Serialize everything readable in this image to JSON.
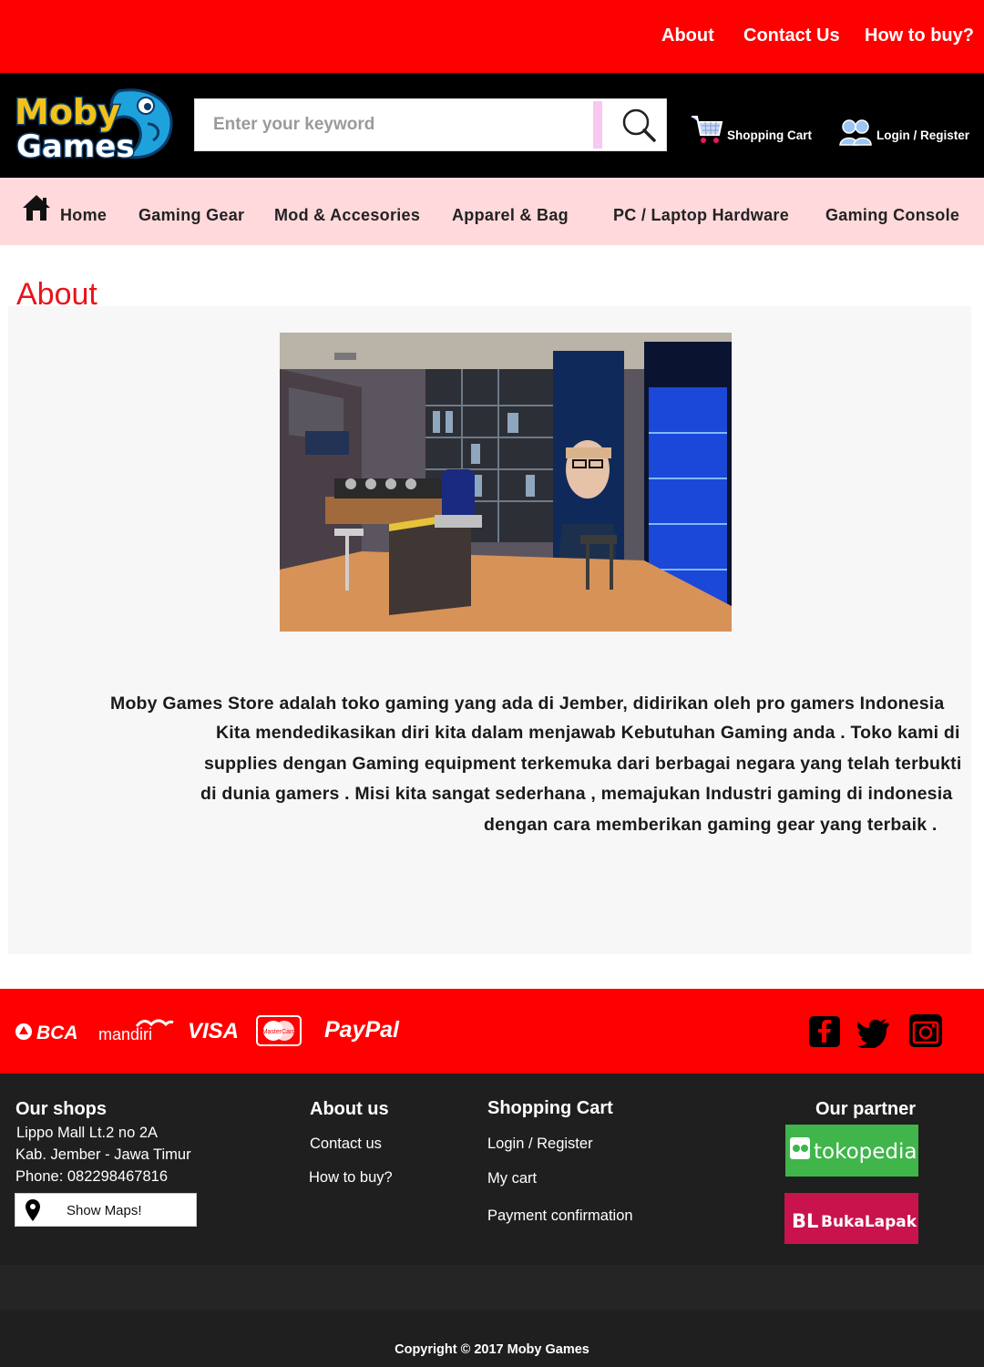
{
  "topnav": {
    "about": "About",
    "contact": "Contact Us",
    "howto": "How to buy?"
  },
  "brand": {
    "line1": "Moby",
    "line2": "Games"
  },
  "search": {
    "placeholder": "Enter your keyword"
  },
  "header": {
    "cart": "Shopping Cart",
    "login": "Login / Register"
  },
  "nav": {
    "home": "Home",
    "gaming_gear": "Gaming Gear",
    "mod": "Mod & Accesories",
    "apparel": "Apparel & Bag",
    "pc": "PC / Laptop Hardware",
    "console": "Gaming Console"
  },
  "about": {
    "title": "About",
    "lines": [
      "Moby Games Store adalah toko gaming yang ada di Jember, didirikan oleh pro gamers Indonesia",
      "Kita mendedikasikan diri kita dalam menjawab Kebutuhan Gaming anda . Toko kami di",
      "supplies dengan Gaming equipment terkemuka dari berbagai negara yang telah terbukti",
      "di dunia gamers . Misi kita sangat sederhana , memajukan Industri gaming di indonesia",
      "dengan cara memberikan gaming gear yang terbaik ."
    ]
  },
  "payments": {
    "bca": "BCA",
    "mandiri": "mandiri",
    "visa": "VISA",
    "mastercard": "MasterCard",
    "paypal": "PayPal"
  },
  "footer": {
    "shops_title": "Our shops",
    "shops_lines": [
      "Lippo Mall Lt.2 no 2A",
      "Kab. Jember - Jawa Timur",
      "Phone: 082298467816"
    ],
    "maps_button": "Show Maps!",
    "about_title": "About us",
    "about_links": [
      "Contact us",
      "How to buy?"
    ],
    "cart_title": "Shopping Cart",
    "cart_links": [
      "Login / Register",
      "My cart",
      "Payment confirmation"
    ],
    "partner_title": "Our partner",
    "partners": {
      "tokopedia": "tokopedia",
      "bukalapak_bl": "BL",
      "bukalapak": "BukaLapak"
    },
    "copyright": "Copyright © 2017 Moby Games"
  },
  "colors": {
    "brand_red": "#ff0000",
    "title_red": "#e8141b",
    "nav_pink": "#ffd9dc",
    "footer_dark": "#1f1f1f"
  }
}
